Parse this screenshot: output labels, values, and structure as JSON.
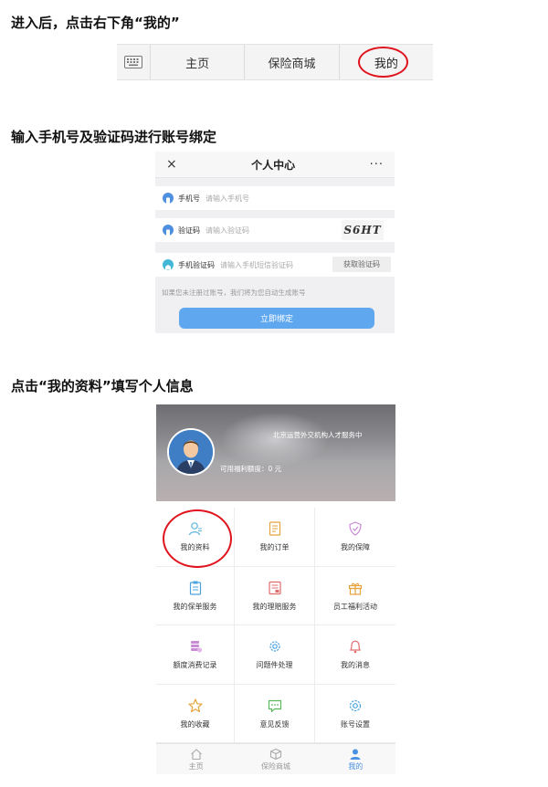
{
  "steps": [
    {
      "title": "进入后，点击右下角“我的”"
    },
    {
      "title": "输入手机号及验证码进行账号绑定"
    },
    {
      "title": "点击“我的资料”填写个人信息"
    }
  ],
  "tabbar1": {
    "tabs": [
      "主页",
      "保险商城",
      "我的"
    ]
  },
  "form": {
    "header": {
      "title": "个人中心",
      "close": "×",
      "more": "···"
    },
    "phone": {
      "label": "手机号",
      "placeholder": "请输入手机号"
    },
    "captcha": {
      "label": "验证码",
      "placeholder": "请输入验证码",
      "image_text": "S6HT"
    },
    "sms": {
      "label": "手机验证码",
      "placeholder": "请输入手机短信验证码",
      "button": "获取验证码"
    },
    "note": "如果您未注册过账号，我们将为您自动生成账号",
    "submit": "立即绑定"
  },
  "profile": {
    "org": "北京运营外交机构人才服务中",
    "quota": "可用福利额度：0 元",
    "menu": [
      {
        "label": "我的资料",
        "icon": "person-icon"
      },
      {
        "label": "我的订单",
        "icon": "order-icon"
      },
      {
        "label": "我的保障",
        "icon": "shield-icon"
      },
      {
        "label": "我的保单服务",
        "icon": "clipboard-icon"
      },
      {
        "label": "我的理赔服务",
        "icon": "claim-icon"
      },
      {
        "label": "员工福利活动",
        "icon": "gift-icon"
      },
      {
        "label": "额度消费记录",
        "icon": "coins-icon"
      },
      {
        "label": "问题件处理",
        "icon": "gear-icon"
      },
      {
        "label": "我的消息",
        "icon": "bell-icon"
      },
      {
        "label": "我的收藏",
        "icon": "star-icon"
      },
      {
        "label": "意见反馈",
        "icon": "chat-icon"
      },
      {
        "label": "账号设置",
        "icon": "settings-icon"
      }
    ],
    "tabbar": [
      "主页",
      "保险商城",
      "我的"
    ]
  },
  "colors": {
    "highlight_ring": "#e0141e",
    "primary_button": "#5fa8f0",
    "active_tab": "#4a90e2"
  }
}
